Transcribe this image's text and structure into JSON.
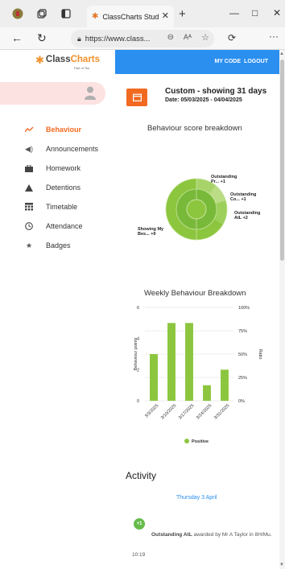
{
  "browser": {
    "tab_title": "ClassCharts Studi",
    "url_host": "https://www.class...",
    "read_aloud": "Aᴬ",
    "new_tab": "+",
    "minimize": "—",
    "maximize": "□",
    "close": "✕"
  },
  "logo": {
    "word1": "Class",
    "word2": "Charts",
    "sub": "Part of Tes"
  },
  "sidebar": {
    "items": [
      {
        "label": "Behaviour",
        "icon": "chart-line-icon",
        "active": true
      },
      {
        "label": "Announcements",
        "icon": "megaphone-icon"
      },
      {
        "label": "Homework",
        "icon": "briefcase-icon"
      },
      {
        "label": "Detentions",
        "icon": "warning-icon"
      },
      {
        "label": "Timetable",
        "icon": "calendar-grid-icon"
      },
      {
        "label": "Attendance",
        "icon": "clock-icon"
      },
      {
        "label": "Badges",
        "icon": "star-icon"
      }
    ]
  },
  "topnav": {
    "my_code": "MY CODE",
    "logout": "LOGOUT"
  },
  "filter": {
    "title": "Custom - showing 31 days",
    "range": "Date: 05/03/2025 - 04/04/2025"
  },
  "colors": {
    "accent": "#f26a21",
    "brand_blue": "#2b8ff0",
    "positive": "#8cc63f"
  },
  "breakdown": {
    "title": "Behaviour score breakdown",
    "labels": [
      {
        "l1": "Outstanding",
        "l2": "Pr... +1"
      },
      {
        "l1": "Outstanding",
        "l2": "Co... +1"
      },
      {
        "l1": "Outstanding",
        "l2": "AtL +2"
      },
      {
        "l1": "Showing My",
        "l2": "Bes... +9"
      }
    ]
  },
  "chart_data": {
    "type": "bar",
    "title": "Weekly Behaviour Breakdown",
    "categories": [
      "3/3/2025",
      "3/10/2025",
      "3/17/2025",
      "3/24/2025",
      "3/31/2025"
    ],
    "series": [
      {
        "name": "Positive",
        "values": [
          3,
          5,
          5,
          1,
          2
        ]
      }
    ],
    "ylabel": "Behaviour points",
    "y2label": "Ratio",
    "ylim": [
      0,
      6
    ],
    "yticks": [
      "0",
      "2",
      "4",
      "6"
    ],
    "y2ticks": [
      "0%",
      "25%",
      "50%",
      "75%",
      "100%"
    ],
    "grid": true,
    "legend": "bottom"
  },
  "activity": {
    "title": "Activity",
    "date": "Thursday 3 April",
    "badge": "+1",
    "behaviour": "Outstanding AtL",
    "awarded_by": " awarded by Mr A Taylor in 8H/Mu.",
    "time": "10:19"
  }
}
